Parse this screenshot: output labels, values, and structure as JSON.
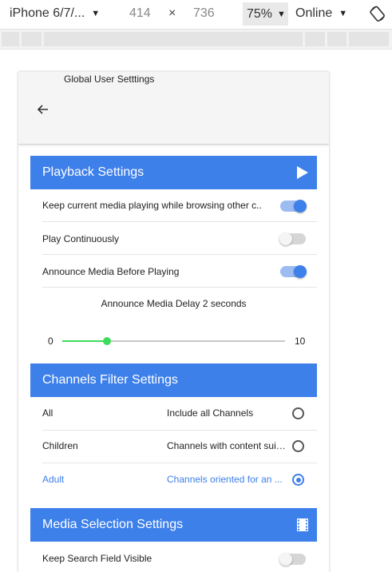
{
  "devtools": {
    "device": "iPhone 6/7/...",
    "width": "414",
    "times": "×",
    "height": "736",
    "zoom": "75%",
    "network": "Online"
  },
  "app": {
    "title": "Global User Setttings"
  },
  "playback": {
    "heading": "Playback Settings",
    "items": [
      {
        "label": "Keep current media playing while browsing other c...",
        "on": true
      },
      {
        "label": "Play Continuously",
        "on": false
      },
      {
        "label": "Announce Media Before Playing",
        "on": true
      }
    ],
    "delay_label": "Announce Media Delay 2 seconds",
    "slider": {
      "min": "0",
      "max": "10",
      "value": 2
    }
  },
  "channels": {
    "heading": "Channels Filter Settings",
    "options": [
      {
        "name": "All",
        "description": "Include all Channels",
        "selected": false
      },
      {
        "name": "Children",
        "description": "Channels with content suit...",
        "selected": false
      },
      {
        "name": "Adult",
        "description": "Channels oriented for an ...",
        "selected": true
      }
    ]
  },
  "media_selection": {
    "heading": "Media Selection Settings",
    "items": [
      {
        "label": "Keep Search Field Visible",
        "on": false
      }
    ]
  },
  "colors": {
    "accent": "#3e80ea",
    "slider": "#3ddc5a"
  }
}
